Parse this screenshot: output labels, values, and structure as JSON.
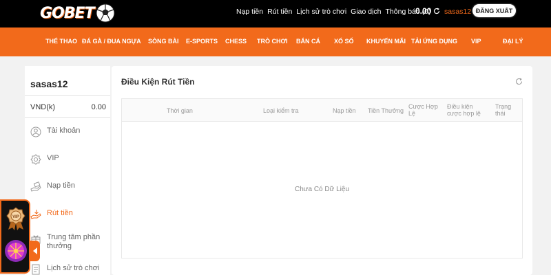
{
  "brand": {
    "logo_text": "GOBET",
    "accent": "#f26a1b"
  },
  "topbar": {
    "links": [
      "Nạp tiền",
      "Rút tiền",
      "Lịch sử trò chơi",
      "Giao dịch",
      "Thông báo (0)"
    ],
    "balance": "0.00",
    "username": "sasas12",
    "logout_label": "ĐĂNG XUẤT"
  },
  "nav": [
    "THỂ THAO",
    "ĐÁ GÀ / ĐUA NGỰA",
    "SÒNG BÀI",
    "E-SPORTS",
    "CHESS",
    "TRÒ CHƠI",
    "BẮN CÁ",
    "XỔ SỐ",
    "KHUYẾN MÃI",
    "TẢI ỨNG DỤNG",
    "VIP",
    "ĐẠI LÝ"
  ],
  "sidebar": {
    "username": "sasas12",
    "currency": "VND(k)",
    "balance": "0.00",
    "items": [
      {
        "label": "Tài khoản",
        "icon": "user-icon"
      },
      {
        "label": "VIP",
        "icon": "vip-badge-icon"
      },
      {
        "label": "Nạp tiền",
        "icon": "deposit-hand-icon"
      },
      {
        "label": "Rút tiền",
        "icon": "withdraw-icon"
      },
      {
        "label": "Trung tâm phần thưởng",
        "icon": "reward-icon"
      },
      {
        "label": "Lịch sử trò chơi",
        "icon": "history-icon"
      }
    ]
  },
  "panel": {
    "title": "Điều Kiện Rút Tiền",
    "columns": [
      "Thời gian",
      "Loại kiểm tra",
      "Nạp tiền",
      "Tiền Thưởng",
      "Cược Hợp Lệ",
      "Điều kiện cược hợp lệ",
      "Trạng thái"
    ],
    "empty_text": "Chưa Có Dữ Liệu"
  },
  "floating_promo": {
    "vip_badge": "VIP"
  }
}
